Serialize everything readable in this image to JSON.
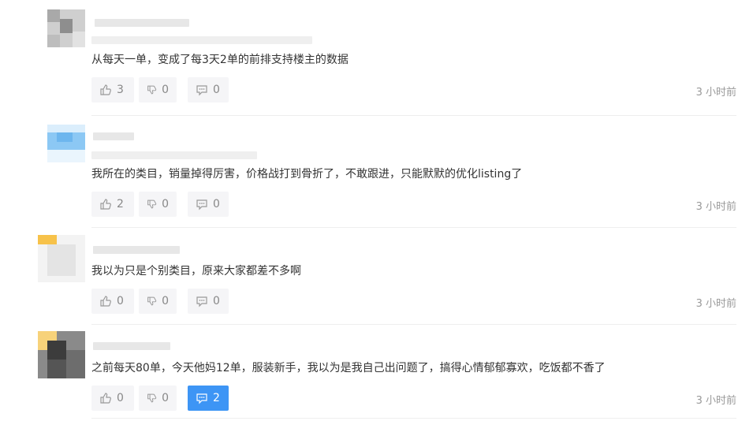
{
  "comments": [
    {
      "text": "从每天一单，变成了每3天2单的前排支持楼主的数据",
      "likes": "3",
      "dislikes": "0",
      "replies": "0",
      "time": "3 小时前",
      "reply_active": false
    },
    {
      "text": "我所在的类目，销量掉得厉害，价格战打到骨折了，不敢跟进，只能默默的优化listing了",
      "likes": "2",
      "dislikes": "0",
      "replies": "0",
      "time": "3 小时前",
      "reply_active": false
    },
    {
      "text": "我以为只是个别类目，原来大家都差不多啊",
      "likes": "0",
      "dislikes": "0",
      "replies": "0",
      "time": "3 小时前",
      "reply_active": false
    },
    {
      "text": "之前每天80单，今天他妈12单，服装新手，我以为是我自己出问题了，搞得心情郁郁寡欢，吃饭都不香了",
      "likes": "0",
      "dislikes": "0",
      "replies": "2",
      "time": "3 小时前",
      "reply_active": true
    }
  ],
  "colors": {
    "accent": "#3d95f5",
    "button_bg": "#f5f5f7",
    "muted_text": "#999999"
  }
}
